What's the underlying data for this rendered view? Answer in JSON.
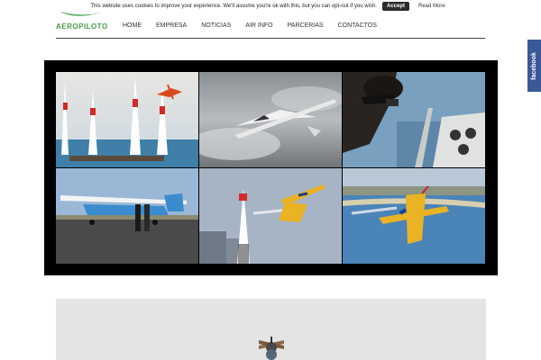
{
  "cookie": {
    "message": "This website uses cookies to improve your experience. We'll assume you're ok with this, but you can opt-out if you wish.",
    "accept_label": "Accept",
    "read_more_label": "Read More"
  },
  "header": {
    "logo_text": "AEROPILOTO",
    "nav": [
      {
        "label": "HOME"
      },
      {
        "label": "EMPRESA"
      },
      {
        "label": "NOTICIAS"
      },
      {
        "label": "AIR INFO"
      },
      {
        "label": "PARCERIAS"
      },
      {
        "label": "CONTACTOS"
      }
    ]
  },
  "facebook": {
    "label": "facebook"
  },
  "gallery": {
    "photos": [
      {
        "name": "air-race-pylons-photo"
      },
      {
        "name": "glider-in-clouds-photo"
      },
      {
        "name": "pilot-cockpit-photo"
      },
      {
        "name": "cessna-on-ground-photo"
      },
      {
        "name": "race-plane-pylon-photo"
      },
      {
        "name": "plane-over-beach-photo"
      }
    ]
  },
  "colors": {
    "logo_green": "#4a9a4a",
    "facebook_blue": "#3b5998",
    "accept_bg": "#2b2b2b"
  }
}
